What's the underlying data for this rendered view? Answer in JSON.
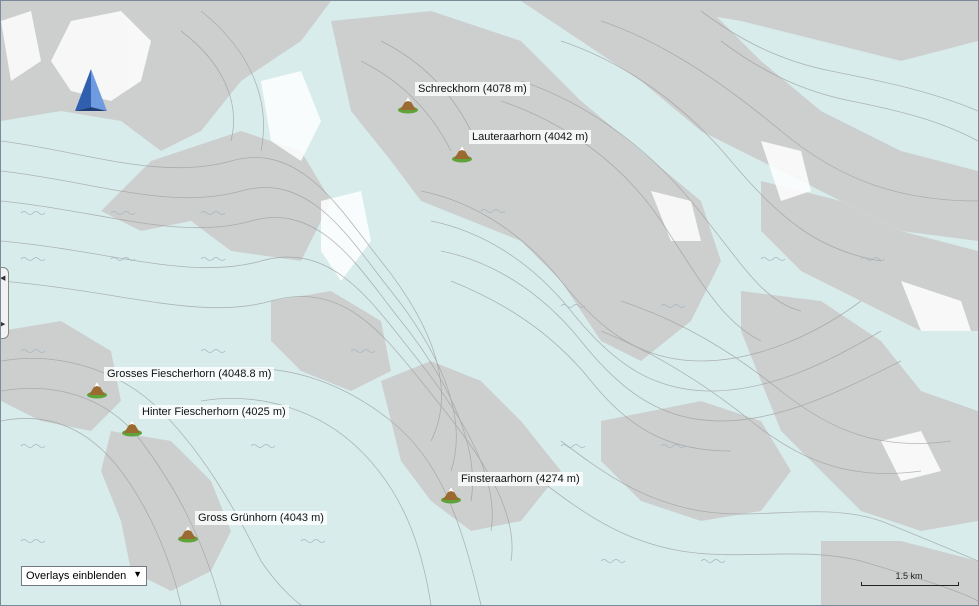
{
  "map": {
    "colors": {
      "background": "#d8ecec",
      "rock": "#cccccc",
      "contour": "#9c9c9c",
      "glacier_wave": "#a8b6be",
      "peak_fill": "#9a6a30",
      "peak_base": "#5ea43a",
      "marker": "#3a6fbf"
    },
    "peaks": [
      {
        "id": "schreckhorn",
        "label": "Schreckhorn (4078 m)"
      },
      {
        "id": "lauteraarhorn",
        "label": "Lauteraarhorn (4042 m)"
      },
      {
        "id": "grosses-fiescherhorn",
        "label": "Grosses Fiescherhorn (4048.8 m)"
      },
      {
        "id": "hinter-fiescherhorn",
        "label": "Hinter Fiescherhorn (4025 m)"
      },
      {
        "id": "finsteraarhorn",
        "label": "Finsteraarhorn (4274 m)"
      },
      {
        "id": "gross-gruenhorn",
        "label": "Gross Grünhorn (4043 m)"
      }
    ],
    "overlay_dropdown": {
      "selected": "Overlays einblenden"
    },
    "scale": {
      "label": "1.5 km"
    },
    "marker_icon": "blue-pyramid-position-icon",
    "peak_icon": "mountain-peak-icon"
  }
}
